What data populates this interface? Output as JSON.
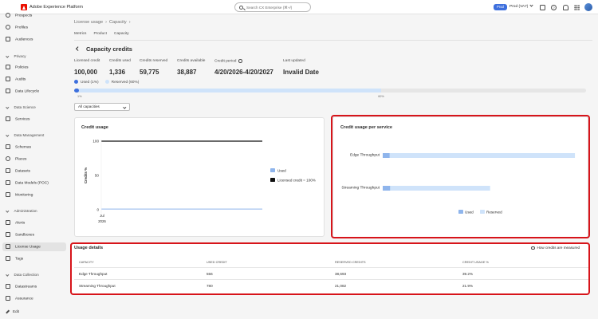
{
  "app": {
    "title": "Adobe Experience Platform",
    "search_placeholder": "Search CX Enterprise (⌘+/)",
    "env_badge": "Prod",
    "sandbox": "Prod (VA7)"
  },
  "sidebar": {
    "prospects": "Prospects",
    "items_top": [
      "Profiles",
      "Audiences"
    ],
    "sections": {
      "privacy": {
        "title": "Privacy",
        "items": [
          "Policies",
          "Audits",
          "Data Lifecycle"
        ]
      },
      "data_science": {
        "title": "Data Science",
        "items": [
          "Services"
        ]
      },
      "data_management": {
        "title": "Data Management",
        "items": [
          "Schemas",
          "Places",
          "Datasets",
          "Data Models (POC)",
          "Monitoring"
        ]
      },
      "administration": {
        "title": "Administration",
        "items": [
          "Alerts",
          "Sandboxes",
          "License Usage",
          "Tags"
        ]
      },
      "data_collection": {
        "title": "Data Collection",
        "items": [
          "Datastreams",
          "Assurance"
        ]
      }
    },
    "edit": "Edit"
  },
  "breadcrumb": [
    "License usage",
    "Capacity"
  ],
  "subnav": [
    "Metrics",
    "Product",
    "Capacity"
  ],
  "page_title": "Capacity credits",
  "stats": [
    {
      "label": "Licensed credit",
      "value": "100,000"
    },
    {
      "label": "Credits used",
      "value": "1,336"
    },
    {
      "label": "Credits reserved",
      "value": "59,775"
    },
    {
      "label": "Credits available",
      "value": "38,887"
    },
    {
      "label": "Credit period",
      "value": "4/20/2026-4/20/2027"
    },
    {
      "label": "Last updated",
      "value": "Invalid Date"
    }
  ],
  "progress": {
    "used_label": "Used (1%)",
    "reserved_label": "Reserved (60%)",
    "used_pct": 1,
    "reserved_pct": 60,
    "tick_start": "1%",
    "tick_reserved": "60%",
    "used_color": "#3d6fdd",
    "reserved_color": "#cfe3fa"
  },
  "filter": {
    "selected": "All capacities"
  },
  "credit_usage": {
    "title": "Credit usage",
    "legend_used": "Used",
    "legend_line": "Licensed credit = 100%",
    "chart_data": {
      "type": "line",
      "x": [
        "Jul 2026"
      ],
      "x_tick_line1": "Jul",
      "x_tick_line2": "2026",
      "ylabel": "Credits %",
      "ylim": [
        0,
        100
      ],
      "yticks": [
        "0",
        "50",
        "100"
      ],
      "series": [
        {
          "name": "Used",
          "values": [
            1
          ]
        },
        {
          "name": "Licensed credit = 100%",
          "values": [
            100
          ]
        }
      ]
    }
  },
  "credit_per_service": {
    "title": "Credit usage per service",
    "legend_used": "Used",
    "legend_reserved": "Reserved",
    "chart_data": {
      "type": "bar",
      "categories": [
        "Edge Throughput",
        "Streaming Throughput"
      ],
      "series": [
        {
          "name": "Used",
          "values": [
            1.4,
            1.5
          ]
        },
        {
          "name": "Reserved",
          "values": [
            39.2,
            21.9
          ]
        }
      ]
    }
  },
  "usage_details": {
    "title": "Usage details",
    "how_link": "How credits are measured",
    "columns": [
      "Capacity",
      "Used credit",
      "Reserved credits",
      "Credit usage %"
    ],
    "rows": [
      [
        "Edge Throughput",
        "556",
        "38,693",
        "39.2%"
      ],
      [
        "Streaming Throughput",
        "780",
        "21,082",
        "21.9%"
      ]
    ]
  }
}
